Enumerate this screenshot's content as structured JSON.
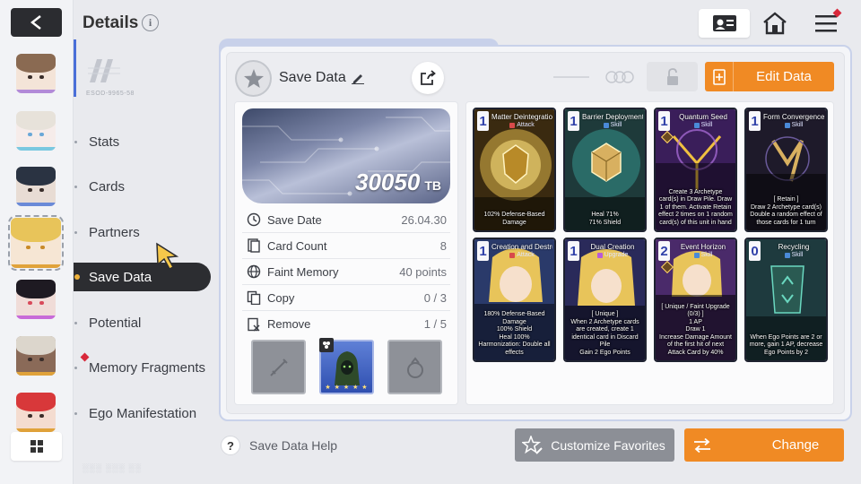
{
  "header": {
    "title": "Details",
    "info_glyph": "i"
  },
  "emblem_code": "ESOD-9965-58",
  "menu": {
    "items": [
      {
        "label": "Stats",
        "active": false
      },
      {
        "label": "Cards",
        "active": false
      },
      {
        "label": "Partners",
        "active": false
      },
      {
        "label": "Save Data",
        "active": true
      },
      {
        "label": "Potential",
        "active": false
      },
      {
        "label": "Memory Fragments",
        "active": false,
        "notification": true
      },
      {
        "label": "Ego Manifestation",
        "active": false
      }
    ]
  },
  "save_data": {
    "title": "Save Data",
    "tb_value": "30050",
    "tb_unit": "TB",
    "stats": [
      {
        "label": "Save Date",
        "value": "26.04.30",
        "icon": "clock-icon"
      },
      {
        "label": "Card Count",
        "value": "8",
        "icon": "cards-icon"
      },
      {
        "label": "Faint Memory",
        "value": "40 points",
        "icon": "globe-icon"
      },
      {
        "label": "Copy",
        "value": "0 / 3",
        "icon": "copy-icon"
      },
      {
        "label": "Remove",
        "value": "1 / 5",
        "icon": "remove-icon"
      }
    ],
    "hero_stars": "★ ★ ★ ★ ★"
  },
  "actions": {
    "edit_label": "Edit Data",
    "help_label": "Save Data Help",
    "help_glyph": "?",
    "favorites_label": "Customize Favorites",
    "change_label": "Change"
  },
  "cards": [
    {
      "cost": "1",
      "name": "Matter Deintegration",
      "type": "Attack",
      "type_color": "#d84a4a",
      "desc": "102% Defense-Based Damage",
      "theme": "gold"
    },
    {
      "cost": "1",
      "name": "Barrier Deployment",
      "type": "Skill",
      "type_color": "#4a8ad8",
      "desc": "Heal 71%\n71% Shield",
      "theme": "gold"
    },
    {
      "cost": "1",
      "name": "Quantum Seed",
      "type": "Skill",
      "type_color": "#4a8ad8",
      "desc": "Create 3 Archetype card(s) in Draw Pile. Draw 1 of them. Activate Retain effect 2 times on 1 random card(s) of this unit in hand",
      "theme": "purple"
    },
    {
      "cost": "1",
      "name": "Form Convergence",
      "type": "Skill",
      "type_color": "#4a8ad8",
      "desc": "[ Retain ]\nDraw 2 Archetype card(s)\nDouble a random effect of those cards for 1 turn",
      "theme": "dark"
    },
    {
      "cost": "1",
      "name": "Creation and Destruction",
      "type": "Attack",
      "type_color": "#d84a4a",
      "desc": "180% Defense-Based Damage\n100% Shield\nHeal 100%\nHarmonization: Double all effects",
      "theme": "blue"
    },
    {
      "cost": "1",
      "name": "Dual Creation",
      "type": "Upgrade",
      "type_color": "#b85ad8",
      "desc": "[ Unique ]\nWhen 2 Archetype cards are created, create 1 identical card in Discard Pile\nGain 2 Ego Points",
      "theme": "blue"
    },
    {
      "cost": "2",
      "name": "Event Horizon",
      "type": "Skill",
      "type_color": "#4a8ad8",
      "desc": "[ Unique / Faint Upgrade (0/3) ]\n1 AP\nDraw 1\nIncrease Damage Amount of the first hit of next Attack Card by 40%",
      "theme": "violet"
    },
    {
      "cost": "0",
      "name": "Recycling",
      "type": "Skill",
      "type_color": "#4a8ad8",
      "desc": "When Ego Points are 2 or more, gain 1 AP, decrease Ego Points by 2",
      "theme": "teal"
    }
  ]
}
